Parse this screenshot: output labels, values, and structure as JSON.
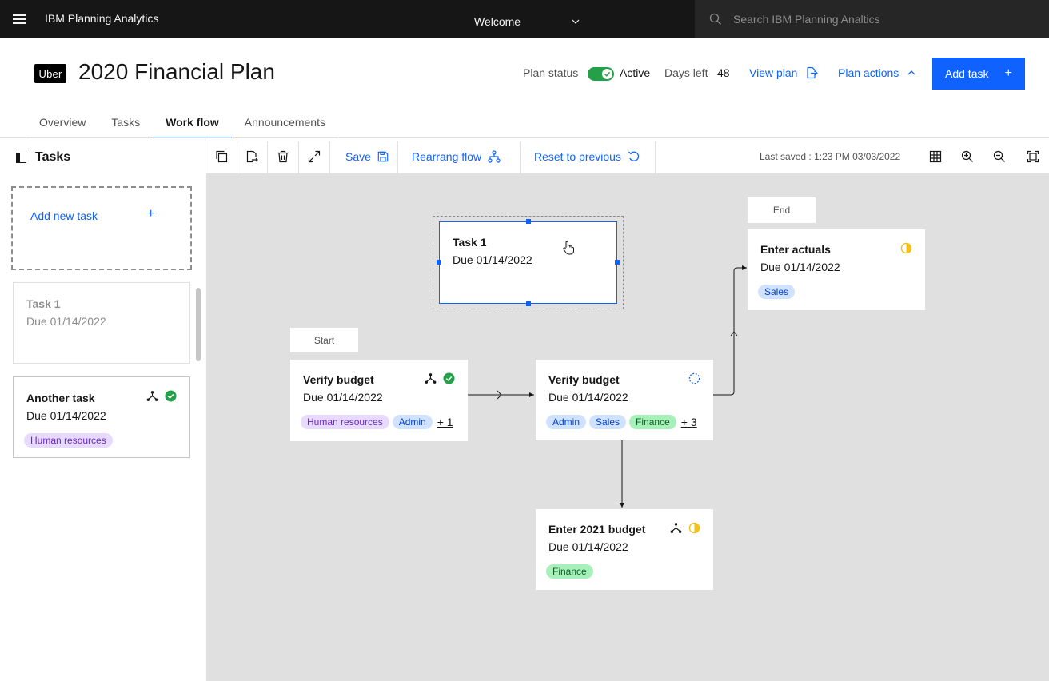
{
  "topbar": {
    "product_name": "IBM Planning Analytics",
    "welcome": "Welcome",
    "search_placeholder": "Search IBM Planning Analtics"
  },
  "header": {
    "logo": "Uber",
    "title": "2020 Financial Plan",
    "plan_status_label": "Plan status",
    "plan_status_value": "Active",
    "plan_status_on": true,
    "days_left_label": "Days left",
    "days_left_value": "48",
    "view_plan": "View plan",
    "plan_actions": "Plan actions",
    "add_task": "Add task"
  },
  "tabs": [
    {
      "label": "Overview",
      "active": false
    },
    {
      "label": "Tasks",
      "active": false
    },
    {
      "label": "Work flow",
      "active": true
    },
    {
      "label": "Announcements",
      "active": false
    }
  ],
  "left_panel": {
    "title": "Tasks",
    "add_new": "Add new task",
    "cards": [
      {
        "title": "Task 1",
        "due": "Due 01/14/2022",
        "state": "disabled"
      },
      {
        "title": "Another task",
        "due": "Due 01/14/2022",
        "tag": "Human resources",
        "status": "complete"
      }
    ]
  },
  "toolbar": {
    "save": "Save",
    "rearrange": "Rearrang flow",
    "reset": "Reset to previous",
    "last_saved_label": "Last saved :",
    "last_saved_value": "1:23 PM 03/03/2022"
  },
  "canvas": {
    "labels": {
      "start": "Start",
      "end": "End"
    },
    "nodes": {
      "task1": {
        "title": "Task 1",
        "due": "Due 01/14/2022",
        "selected": true
      },
      "verify1": {
        "title": "Verify budget",
        "due": "Due 01/14/2022",
        "tags": [
          "Human resources",
          "Admin"
        ],
        "more": "+ 1",
        "status": "complete"
      },
      "verify2": {
        "title": "Verify budget",
        "due": "Due 01/14/2022",
        "tags": [
          "Admin",
          "Sales",
          "Finance"
        ],
        "more": "+ 3",
        "status": "not-started"
      },
      "enter2021": {
        "title": "Enter 2021 budget",
        "due": "Due 01/14/2022",
        "tags": [
          "Finance"
        ],
        "status": "in-progress"
      },
      "actuals": {
        "title": "Enter actuals",
        "due": "Due 01/14/2022",
        "tags": [
          "Sales"
        ],
        "status": "in-progress"
      }
    }
  },
  "colors": {
    "accent": "#0f62fe",
    "success": "#24a148",
    "warning": "#f1c21b",
    "topbar": "#161616",
    "canvas": "#e0e0e0"
  }
}
